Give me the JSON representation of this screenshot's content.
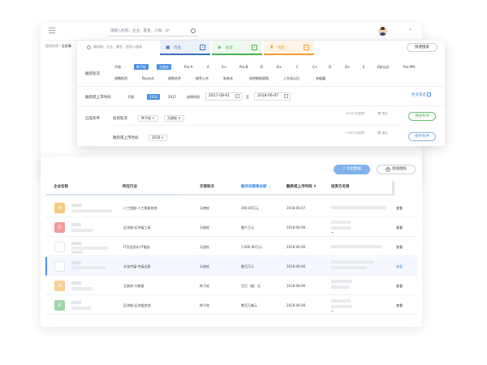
{
  "topbar": {
    "search_placeholder": "请输入机构、企业、基金、人物、LP",
    "icons": [
      "menu-icon",
      "search-icon",
      "avatar",
      "chevron-down-icon"
    ]
  },
  "breadcrumb": {
    "parent": "股权投资",
    "sep": " / ",
    "current": "全部事"
  },
  "filter": {
    "search_placeholder": "搜机构、企业、基金、投资人搜索",
    "categories": [
      {
        "label": "行业",
        "icon": "briefcase-icon",
        "color": "#3d6fb6"
      },
      {
        "label": "标签",
        "icon": "tag-icon",
        "color": "#4caf50"
      },
      {
        "label": "地区",
        "icon": "location-icon",
        "color": "#f39c34"
      }
    ],
    "quick_search": "快速搜索",
    "round_label": "融资轮次",
    "round_options_row1": [
      "不限",
      "种子轮",
      "天使轮",
      "Pre-A",
      "A",
      "A+",
      "Pre-B",
      "B",
      "B+",
      "C",
      "C+",
      "D",
      "D+",
      "E",
      "E轮以后",
      "Pre-IPO"
    ],
    "round_options_row2": [
      "战略投资",
      "Buyout",
      "收购合并",
      "借壳上市",
      "私有化",
      "非控制权收购",
      "上市及以后",
      "未披露"
    ],
    "time_label": "融资或上市时间",
    "time_options": [
      "不限",
      "2018",
      "2017",
      "选择时间"
    ],
    "date_from": "2017-08-01",
    "date_to_word": "至",
    "date_to": "2018-06-07",
    "more_filter": "更多筛选",
    "selected_label": "已选条件",
    "selected_round_label": "投资轮次",
    "selected_round_tags": [
      "种子轮 ×",
      "天使轮 ×"
    ],
    "selected_time_label": "融资或上市时间",
    "selected_time_tags": [
      "2018 ×"
    ],
    "count1": "7678个匹配项",
    "count2": "1780个匹配项",
    "clear_link": "清空",
    "clear_button": "清除条件",
    "save_button": "保存条件"
  },
  "table": {
    "export_button": "导出数据",
    "add_button": "添加指标",
    "headers": [
      "企业名称",
      "所在行业",
      "交易轮次",
      "融资或募集金额",
      "融资或上市时间",
      "投资方名称"
    ],
    "rows": [
      {
        "logo": "B",
        "industry": "人工智能-人工智能其他",
        "round": "天使轮",
        "amount": "300.00万元",
        "date": "2018-06-07",
        "action": "查看"
      },
      {
        "logo": "D",
        "industry": "区块链-区块链工具",
        "round": "天使轮",
        "amount": "数千万元",
        "date": "2018-06-06",
        "action": "查看"
      },
      {
        "logo": "",
        "industry": "IT及信息化-IT服务",
        "round": "天使轮",
        "amount": "1,000.00万元",
        "date": "2018-06-06",
        "action": "查看"
      },
      {
        "logo": "",
        "industry": "文化传媒-传媒出版",
        "round": "天使轮",
        "amount": "数百万元",
        "date": "2018-06-06",
        "action": "查看"
      },
      {
        "logo": "H",
        "industry": "互联网-大数据",
        "round": "种子轮",
        "amount": "百万（级）元",
        "date": "2018-06-06",
        "action": "查看"
      },
      {
        "logo": "E",
        "industry": "区块链-区块链其他",
        "round": "种子轮",
        "amount": "数百万美元",
        "date": "2018-06-06",
        "action": "查看"
      }
    ],
    "logo_colors": [
      "#f5c87a",
      "#f39a9a",
      "#ffffff",
      "#ffffff",
      "#f7cf95",
      "#9fd7a8"
    ]
  }
}
